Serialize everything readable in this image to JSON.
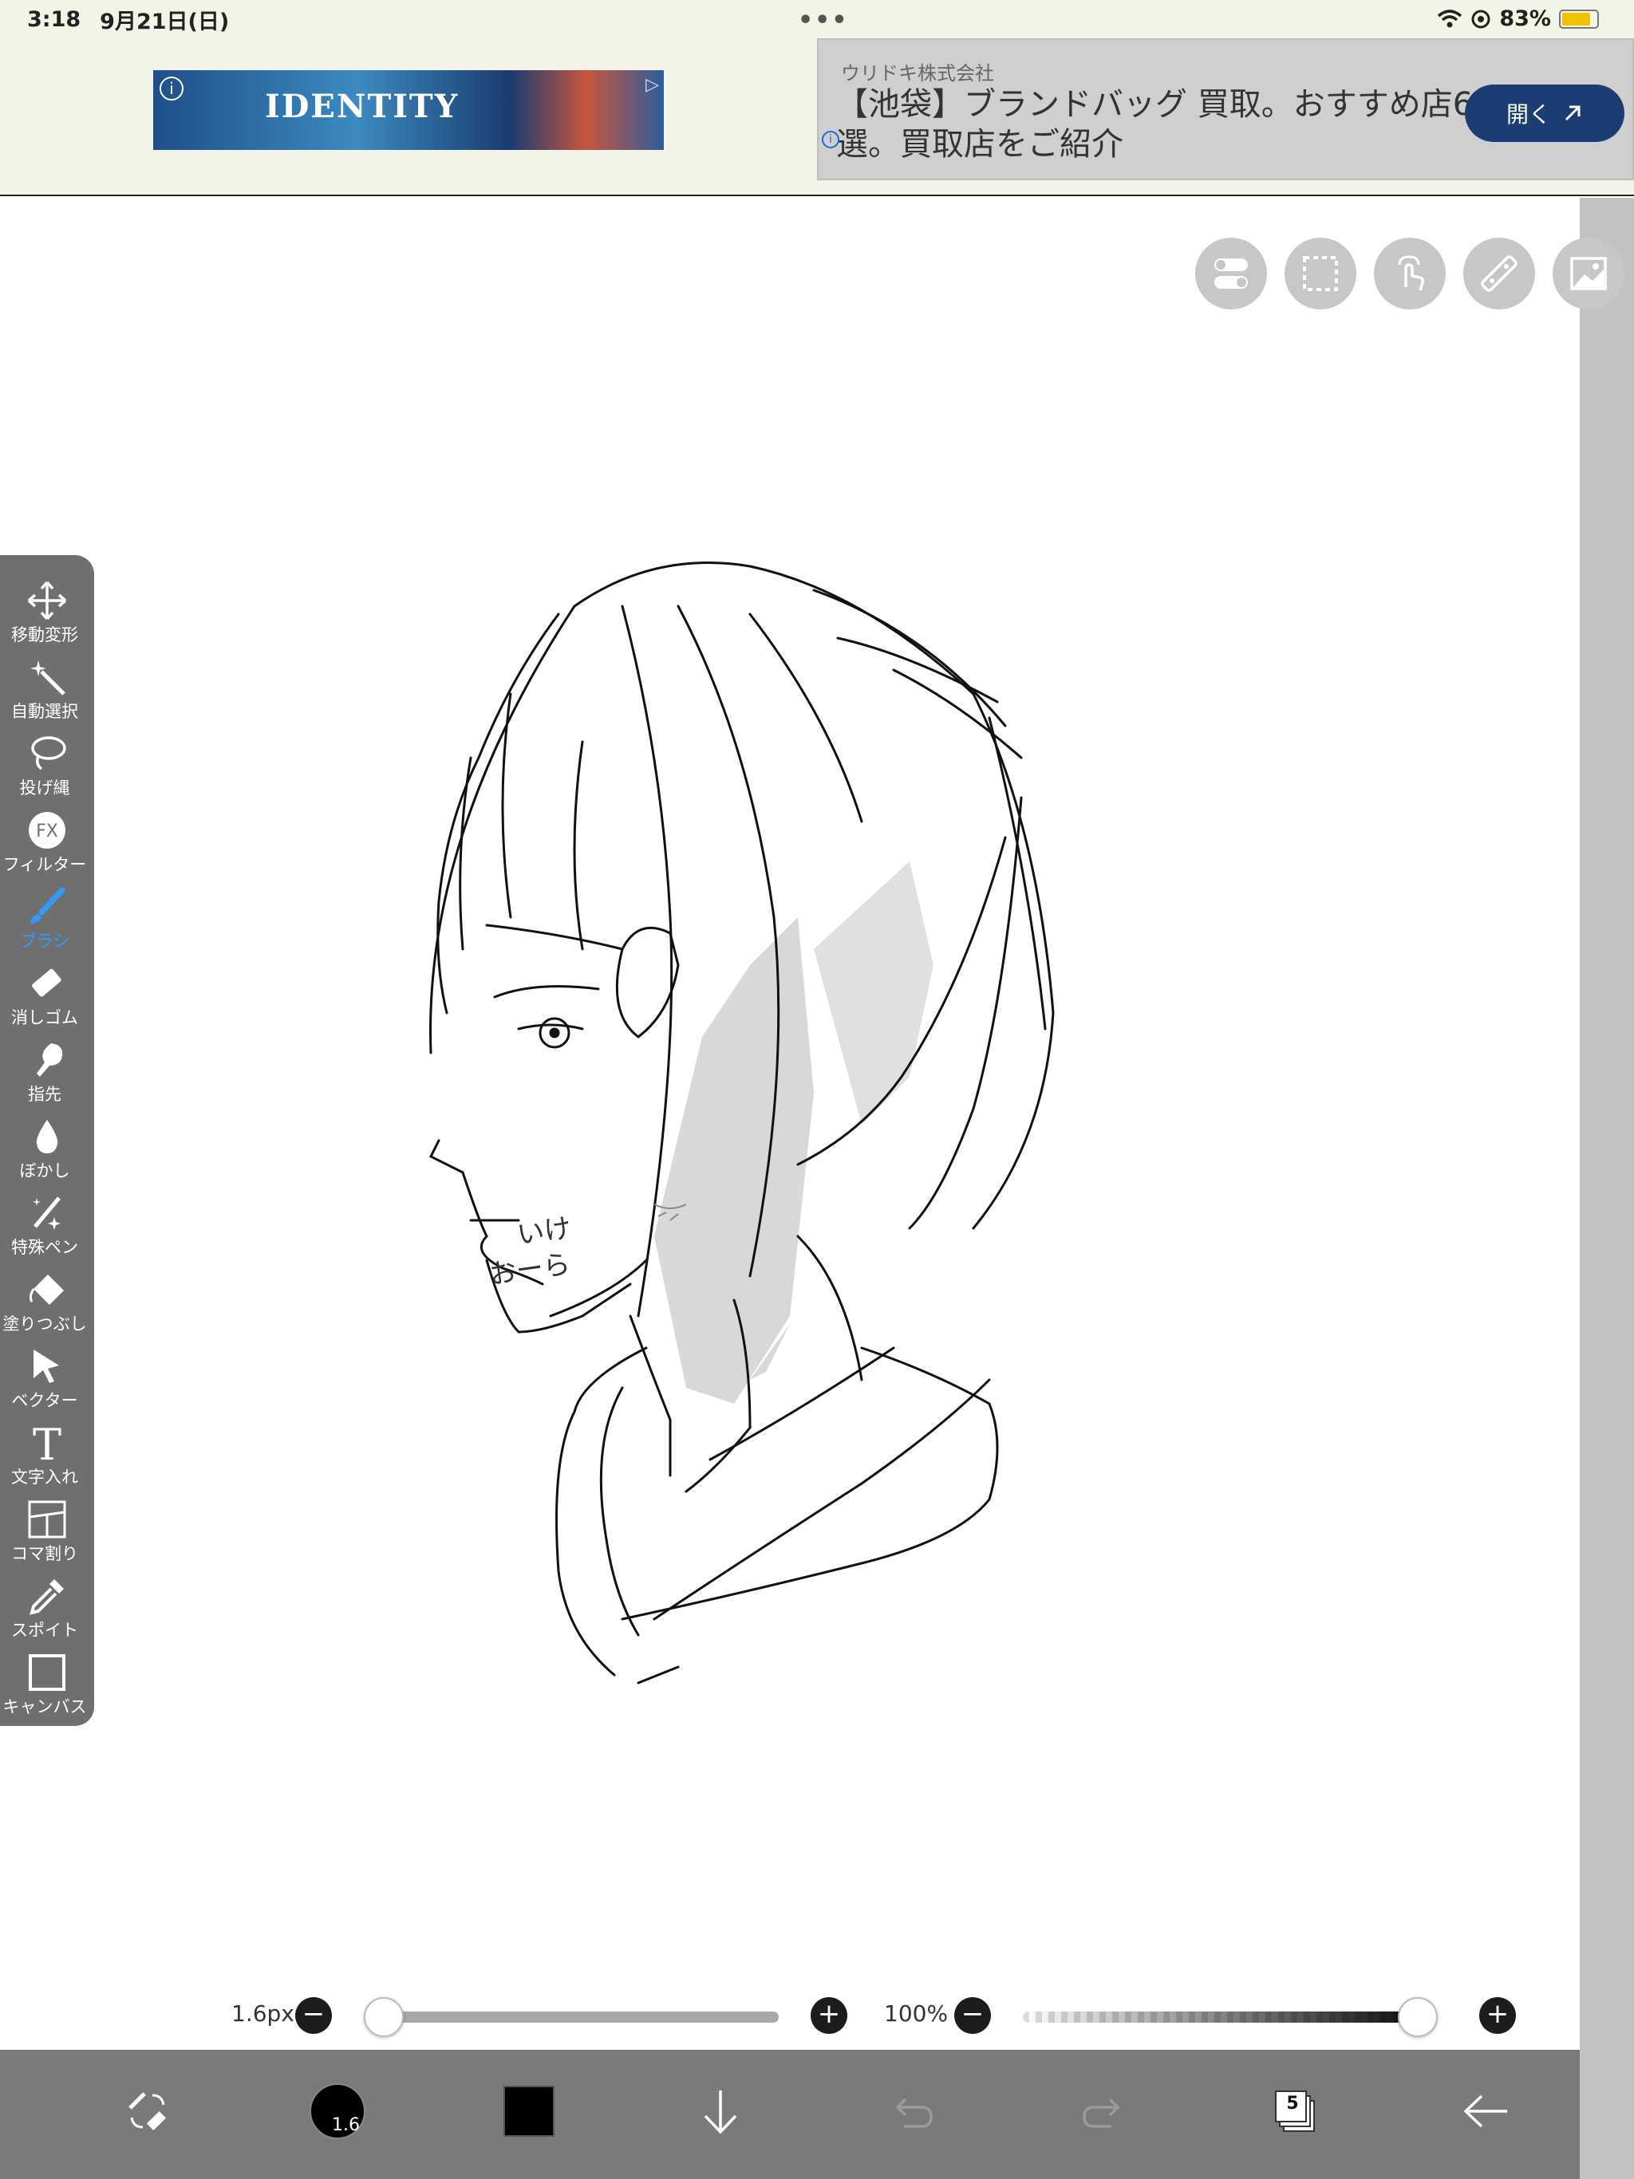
{
  "status_bar": {
    "time": "3:18",
    "date": "9月21日(日)",
    "dots": "•••",
    "battery_percent": "83%",
    "battery_level": 0.83
  },
  "ad": {
    "image_logo": "IDENTITY",
    "advertiser": "ウリドキ株式会社",
    "headline": "【池袋】ブランドバッグ 買取。おすすめ店6選。買取店をご紹介",
    "open_button": "開く",
    "info_glyph": "i"
  },
  "top_tools": [
    {
      "name": "toggle-icon"
    },
    {
      "name": "selection-icon"
    },
    {
      "name": "touch-icon"
    },
    {
      "name": "ruler-icon"
    },
    {
      "name": "image-icon"
    }
  ],
  "tools": [
    {
      "label": "移動変形",
      "icon": "move-icon"
    },
    {
      "label": "自動選択",
      "icon": "magic-wand-icon"
    },
    {
      "label": "投げ縄",
      "icon": "lasso-icon"
    },
    {
      "label": "フィルター",
      "icon": "filter-fx-icon",
      "glyph": "FX"
    },
    {
      "label": "ブラシ",
      "icon": "brush-icon",
      "active": true
    },
    {
      "label": "消しゴム",
      "icon": "eraser-icon"
    },
    {
      "label": "指先",
      "icon": "finger-icon"
    },
    {
      "label": "ぼかし",
      "icon": "blur-drop-icon"
    },
    {
      "label": "特殊ペン",
      "icon": "special-pen-icon"
    },
    {
      "label": "塗りつぶし",
      "icon": "fill-bucket-icon"
    },
    {
      "label": "ベクター",
      "icon": "vector-arrow-icon"
    },
    {
      "label": "文字入れ",
      "icon": "text-icon",
      "glyph": "T"
    },
    {
      "label": "コマ割り",
      "icon": "panel-layout-icon"
    },
    {
      "label": "スポイト",
      "icon": "eyedropper-icon"
    },
    {
      "label": "キャンバス",
      "icon": "canvas-icon"
    }
  ],
  "brush_size": {
    "label": "1.6px",
    "value": 1.6,
    "slider_position": 0.0
  },
  "opacity": {
    "label": "100%",
    "value": 100
  },
  "bottom_bar": {
    "brush_preview_value": "1.6",
    "current_color": "#000000",
    "layer_count": "5"
  },
  "canvas": {
    "handwritten_text": "いけめんおーら"
  },
  "colors": {
    "toolbar_bg": "#6f6f6f",
    "active_tool": "#2f9bff",
    "ad_button": "#1b3d73",
    "bottom_bar": "#7a7a7a"
  }
}
